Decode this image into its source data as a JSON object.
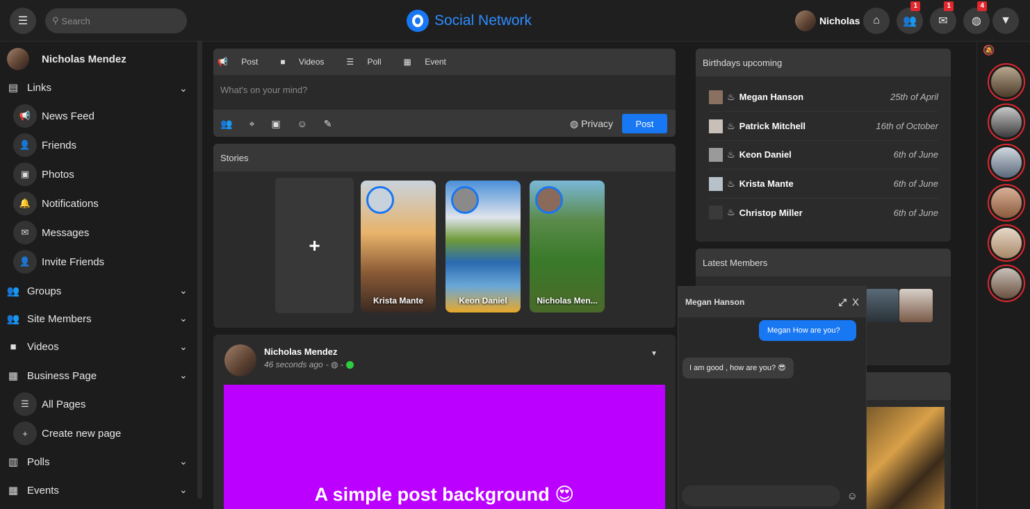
{
  "header": {
    "search_placeholder": "Search",
    "logo_text": "Social Network",
    "user_name": "Nicholas",
    "badges": {
      "friends": "1",
      "messages": "1",
      "notifications": "4"
    }
  },
  "sidebar": {
    "profile_name": "Nicholas Mendez",
    "links_label": "Links",
    "links": [
      "News Feed",
      "Friends",
      "Photos",
      "Notifications",
      "Messages",
      "Invite Friends"
    ],
    "groups_label": "Groups",
    "site_members_label": "Site Members",
    "videos_label": "Videos",
    "business_label": "Business Page",
    "business_links": [
      "All Pages",
      "Create new page"
    ],
    "polls_label": "Polls",
    "events_label": "Events"
  },
  "composer": {
    "tabs": [
      "Post",
      "Videos",
      "Poll",
      "Event"
    ],
    "placeholder": "What's on your mind?",
    "privacy_label": "Privacy",
    "post_label": "Post"
  },
  "stories": {
    "title": "Stories",
    "add_symbol": "+",
    "items": [
      "Krista Mante",
      "Keon Daniel",
      "Nicholas Men..."
    ]
  },
  "post": {
    "author": "Nicholas Mendez",
    "time": "46 seconds ago",
    "text": "A simple post background 😍",
    "bg_color": "#bb00ff"
  },
  "birthdays": {
    "title": "Birthdays upcoming",
    "items": [
      {
        "name": "Megan Hanson",
        "date": "25th of April"
      },
      {
        "name": "Patrick Mitchell",
        "date": "16th of October"
      },
      {
        "name": "Keon Daniel",
        "date": "6th of June"
      },
      {
        "name": "Krista Mante",
        "date": "6th of June"
      },
      {
        "name": "Christop Miller",
        "date": "6th of June"
      }
    ]
  },
  "latest_members": {
    "title": "Latest Members"
  },
  "chat": {
    "name": "Megan Hanson",
    "close_label": "X",
    "outgoing": "Megan How are you?",
    "incoming": "I am good , how are you? 😎"
  },
  "colors": {
    "accent": "#1877f2",
    "badge": "#e0282e",
    "online": "#2ecc40"
  }
}
